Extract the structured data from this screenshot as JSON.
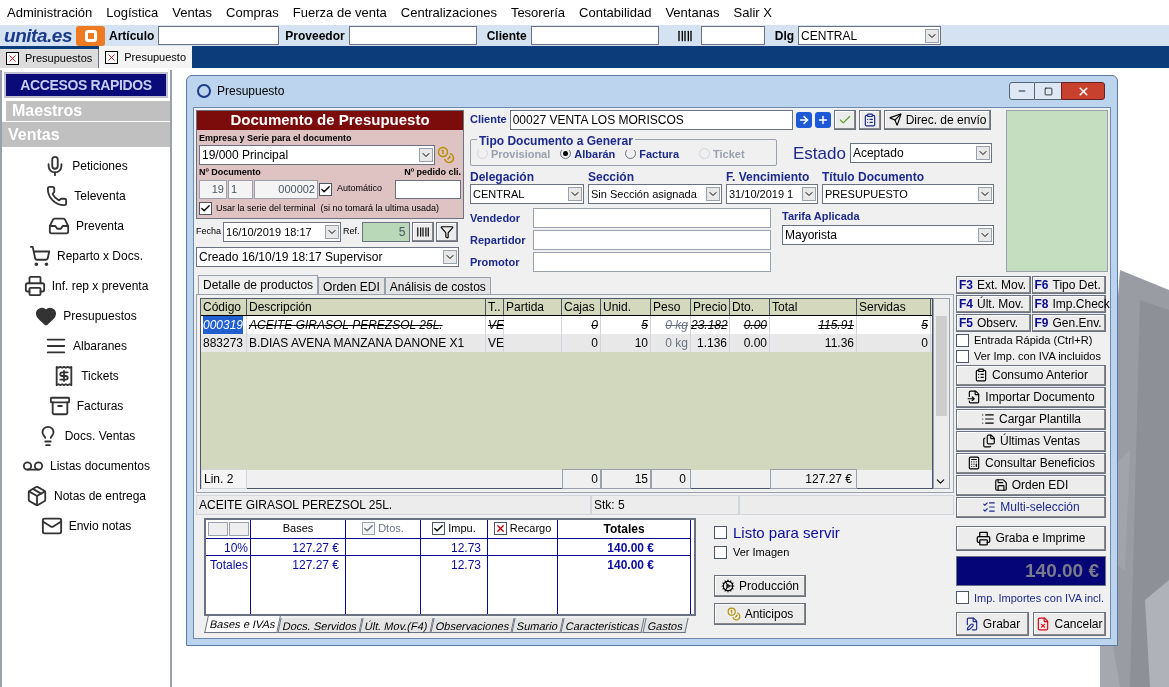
{
  "menu": [
    "Administración",
    "Logística",
    "Ventas",
    "Compras",
    "Fuerza de venta",
    "Centralizaciones",
    "Tesorería",
    "Contabilidad",
    "Ventanas",
    "Salir X"
  ],
  "brand": {
    "name": "unita.es"
  },
  "toolbar": {
    "fields": [
      {
        "label": "Artículo"
      },
      {
        "label": "Proveedor"
      },
      {
        "label": "Cliente"
      }
    ],
    "dlg": {
      "label": "Dlg",
      "value": "CENTRAL"
    }
  },
  "doc_tabs": [
    {
      "label": "Presupuestos",
      "selected": false
    },
    {
      "label": "Presupuesto",
      "selected": true
    }
  ],
  "sidebar": {
    "title": "ACCESOS RAPIDOS",
    "sections": [
      "Maestros",
      "Ventas"
    ],
    "items": [
      {
        "label": "Peticiones"
      },
      {
        "label": "Televenta"
      },
      {
        "label": "Preventa"
      },
      {
        "label": "Reparto x Docs."
      },
      {
        "label": "Inf. rep x preventa"
      },
      {
        "label": "Presupuestos"
      },
      {
        "label": "Albaranes"
      },
      {
        "label": "Tickets"
      },
      {
        "label": "Facturas"
      },
      {
        "label": "Docs. Ventas"
      },
      {
        "label": "Listas documentos"
      },
      {
        "label": "Notas de entrega"
      },
      {
        "label": "Envio notas"
      }
    ]
  },
  "window": {
    "title": "Presupuesto"
  },
  "document": {
    "header": "Documento de Presupuesto",
    "empresa_label": "Empresa y Serie para el documento",
    "empresa_value": "19/000 Principal",
    "num_label": "Nº Documento",
    "pedido_label": "Nº pedido cli.",
    "serie": "19",
    "serie2": "1",
    "numero": "000002",
    "automatico": {
      "label": "Automático",
      "checked": true
    },
    "usar_serie": {
      "label": "Usar la serie del terminal  (si no tomará la ultima usada)",
      "checked": true
    },
    "fecha_label": "Fecha",
    "fecha": "16/10/2019 18:17",
    "ref_label": "Ref.",
    "ref": "5",
    "creado": "Creado 16/10/19 18:17 Supervisor"
  },
  "cliente": {
    "label": "Cliente",
    "value": "00027 VENTA LOS MORISCOS",
    "envio": "Direc. de envío"
  },
  "tipo": {
    "title": "Tipo Documento a Generar",
    "options": [
      {
        "label": "Provisional",
        "selected": false,
        "disabled": true
      },
      {
        "label": "Albarán",
        "selected": true,
        "disabled": false
      },
      {
        "label": "Factura",
        "selected": false,
        "disabled": false
      },
      {
        "label": "Ticket",
        "selected": false,
        "disabled": true
      }
    ]
  },
  "estado": {
    "label": "Estado",
    "value": "Aceptado"
  },
  "selects": [
    {
      "label": "Delegación",
      "value": "CENTRAL"
    },
    {
      "label": "Sección",
      "value": "Sin Sección asignada"
    },
    {
      "label": "F. Vencimiento",
      "value": "31/10/2019 1"
    },
    {
      "label": "Título Documento",
      "value": "PRESUPUESTO"
    }
  ],
  "people": [
    {
      "label": "Vendedor"
    },
    {
      "label": "Repartidor"
    },
    {
      "label": "Promotor"
    }
  ],
  "tarifa": {
    "label": "Tarifa Aplicada",
    "value": "Mayorista"
  },
  "grid_tabs": [
    {
      "label": "Detalle de productos",
      "selected": true
    },
    {
      "label": "Orden EDI",
      "selected": false
    },
    {
      "label": "Análisis de costos",
      "selected": false
    }
  ],
  "table": {
    "columns": [
      "Código",
      "Descripción",
      "T..",
      "Partida",
      "Cajas",
      "Unid.",
      "Peso",
      "Precio",
      "Dto.",
      "Total",
      "Servidas"
    ],
    "rows": [
      {
        "struck": true,
        "selected": true,
        "cells": [
          "000319",
          "ACEITE GIRASOL PEREZSOL 25L.",
          "VE",
          "",
          "0",
          "5",
          "0 kg",
          "23.182",
          "0.00",
          "115.91",
          "5"
        ]
      },
      {
        "struck": false,
        "selected": false,
        "cells": [
          "883273",
          "B.DIAS AVENA MANZANA DANONE X1",
          "VE",
          "",
          "0",
          "10",
          "0 kg",
          "1.136",
          "0.00",
          "11.36",
          "0"
        ]
      }
    ],
    "footer": {
      "lines": "Lin. 2",
      "cajas": "0",
      "unid": "15",
      "peso": "0",
      "total": "127.27 €"
    }
  },
  "status": {
    "description": "ACEITE GIRASOL PEREZSOL 25L.",
    "stock": "Stk: 5"
  },
  "totals": {
    "columns": [
      {
        "label": "Bases",
        "kind": "plain"
      },
      {
        "label": "Dtos.",
        "kind": "checkbox",
        "checked": true,
        "disabled": true
      },
      {
        "label": "Impu.",
        "kind": "checkbox",
        "checked": true,
        "disabled": false
      },
      {
        "label": "Recargo",
        "kind": "crossbox",
        "checked": true,
        "disabled": false
      },
      {
        "label": "Totales",
        "kind": "plain"
      }
    ],
    "rows": [
      {
        "label": "10%",
        "cells": [
          "127.27 €",
          "",
          "12.73",
          "",
          "140.00 €"
        ]
      },
      {
        "label": "Totales",
        "cells": [
          "127.27 €",
          "",
          "12.73",
          "",
          "140.00 €"
        ]
      }
    ]
  },
  "listo": {
    "label": "Listo para servir",
    "checked": false
  },
  "ver_imagen": {
    "label": "Ver Imagen",
    "checked": false
  },
  "side_buttons": [
    "Producción",
    "Anticipos"
  ],
  "bottom_tabs": [
    {
      "label": "Bases e IVAs",
      "selected": true
    },
    {
      "label": "Docs. Servidos",
      "selected": false
    },
    {
      "label": "Últ. Mov.(F4)",
      "selected": false
    },
    {
      "label": "Observaciones",
      "selected": false
    },
    {
      "label": "Sumario",
      "selected": false
    },
    {
      "label": "Características",
      "selected": false
    },
    {
      "label": "Gastos",
      "selected": false
    }
  ],
  "fkeys": [
    {
      "key": "F3",
      "label": "Ext. Mov."
    },
    {
      "key": "F6",
      "label": "Tipo Det."
    },
    {
      "key": "F4",
      "label": "Últ. Mov."
    },
    {
      "key": "F8",
      "label": "Imp.Check"
    },
    {
      "key": "F5",
      "label": "Observ."
    },
    {
      "key": "F9",
      "label": "Gen.Env."
    }
  ],
  "options": [
    {
      "label": "Entrada Rápida (Ctrl+R)",
      "checked": false
    },
    {
      "label": "Ver Imp. con IVA incluidos",
      "checked": false
    }
  ],
  "actions": [
    "Consumo Anterior",
    "Importar Documento",
    "Cargar Plantilla",
    "Últimas Ventas",
    "Consultar Beneficios",
    "Orden EDI",
    "Multi-selección"
  ],
  "graba_imprime": "Graba e Imprime",
  "total": "140.00 €",
  "imp_iva": {
    "label": "Imp. Importes con IVA incl.",
    "checked": false
  },
  "final_buttons": [
    "Grabar",
    "Cancelar"
  ]
}
